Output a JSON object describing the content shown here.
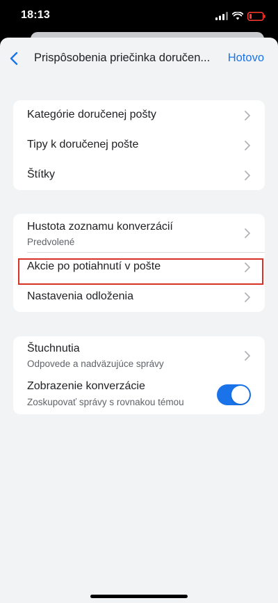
{
  "status_bar": {
    "time": "18:13"
  },
  "nav": {
    "title": "Prispôsobenia priečinka doručen...",
    "done_label": "Hotovo"
  },
  "group1": {
    "items": [
      {
        "label": "Kategórie doručenej pošty"
      },
      {
        "label": "Tipy k doručenej pošte"
      },
      {
        "label": "Štítky"
      }
    ]
  },
  "group2": {
    "items": [
      {
        "label": "Hustota zoznamu konverzácií",
        "sub": "Predvolené"
      },
      {
        "label": "Akcie po potiahnutí v pošte"
      },
      {
        "label": "Nastavenia odloženia"
      }
    ]
  },
  "group3": {
    "items": [
      {
        "label": "Štuchnutia",
        "sub": "Odpovede a nadväzujúce správy"
      },
      {
        "label": "Zobrazenie konverzácie",
        "sub": "Zoskupovať správy s rovnakou témou",
        "toggle_on": true
      }
    ]
  },
  "colors": {
    "accent": "#1a73e8",
    "highlight": "#d93025",
    "background": "#f1f3f4",
    "battery": "#ff3b30"
  }
}
